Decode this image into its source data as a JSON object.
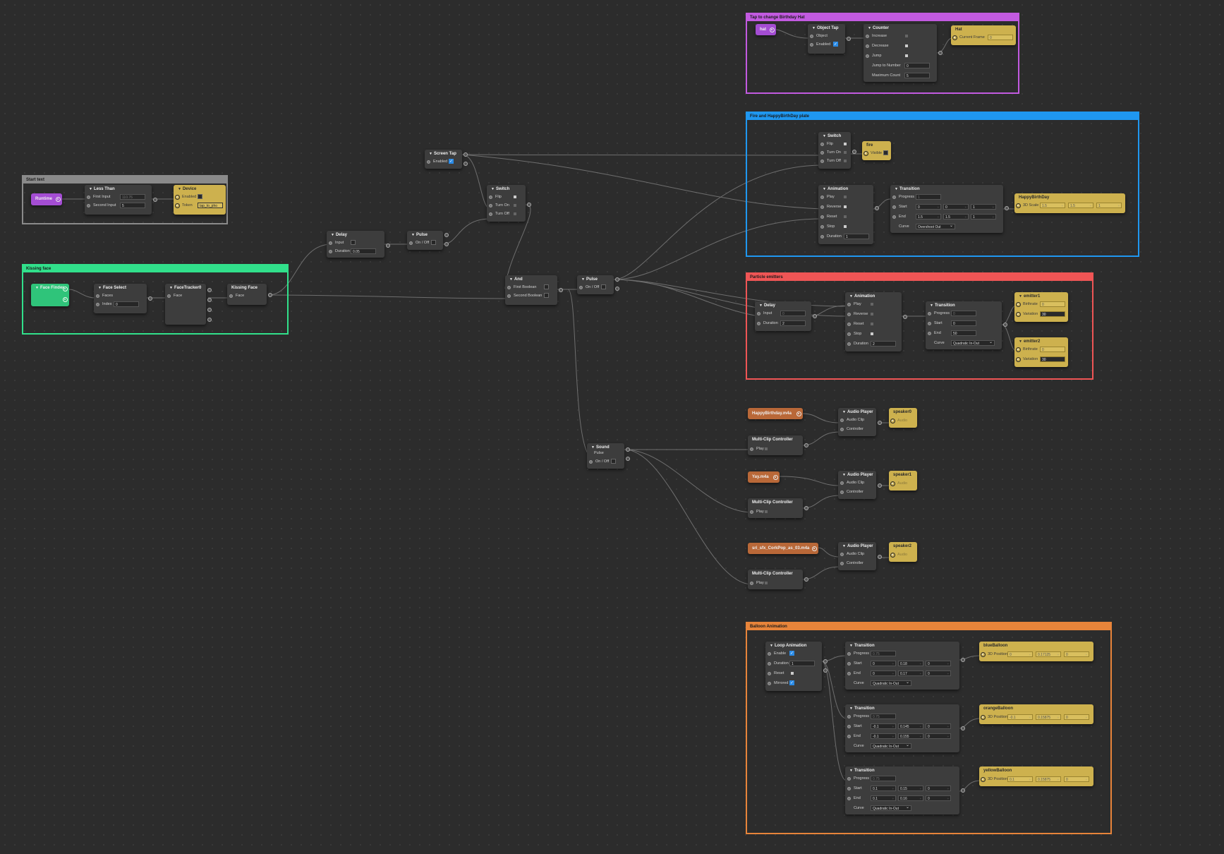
{
  "colors": {
    "background": "#2c2c2c",
    "node": "#3d3d3d",
    "patch_yellow": "#cdb14e",
    "purple": "#a44dd3",
    "green": "#2fc47a",
    "orange_asset": "#b96838",
    "checkbox_blue": "#2b8be6"
  },
  "groups": {
    "start_text": {
      "title": "Start text",
      "color": "#8a8a8a"
    },
    "kissing_face": {
      "title": "Kissing face",
      "color": "#31e08b"
    },
    "birthday_hat": {
      "title": "Tap to change Birthday Hat",
      "color": "#c25ae0"
    },
    "fire_plate": {
      "title": "Fire and HappyBirthDay plate",
      "color": "#1f97f0"
    },
    "particle": {
      "title": "Particle emitters",
      "color": "#ef5555"
    },
    "balloon": {
      "title": "Balloon Animation",
      "color": "#e7843a"
    }
  },
  "nodes": {
    "runtime": {
      "title": "Runtime"
    },
    "less_than": {
      "title": "Less Than",
      "first": "First Input",
      "first_val": "110.76",
      "second": "Second Input",
      "second_val": "5"
    },
    "device": {
      "title": "Device",
      "enabled": "Enabled",
      "token": "Token",
      "token_val": "tap_to_pho"
    },
    "face_finder": {
      "title": "Face Finder"
    },
    "face_select": {
      "title": "Face Select",
      "faces": "Faces",
      "index": "Index",
      "index_val": "0"
    },
    "face_tracker": {
      "title": "FaceTracker0",
      "face": "Face"
    },
    "kissing_face": {
      "title": "Kissing Face",
      "face": "Face"
    },
    "delay1": {
      "title": "Delay",
      "input": "Input",
      "duration": "Duration",
      "duration_val": "0.05"
    },
    "pulse1": {
      "title": "Pulse",
      "onoff": "On / Off"
    },
    "screen_tap": {
      "title": "Screen Tap",
      "enabled": "Enabled"
    },
    "switch1": {
      "title": "Switch",
      "flip": "Flip",
      "turn_on": "Turn On",
      "turn_off": "Turn Off"
    },
    "and": {
      "title": "And",
      "first": "First Boolean",
      "second": "Second Boolean"
    },
    "pulse2": {
      "title": "Pulse",
      "onoff": "On / Off"
    },
    "sound_pulse": {
      "title": "Sound",
      "title2": "Pulse",
      "onoff": "On / Off"
    },
    "hat": {
      "title": "hat"
    },
    "object_tap": {
      "title": "Object Tap",
      "object": "Object",
      "enabled": "Enabled"
    },
    "counter": {
      "title": "Counter",
      "increase": "Increase",
      "decrease": "Decrease",
      "jump": "Jump",
      "jump_to": "Jump to Number",
      "jump_to_val": "0",
      "max": "Maximum Count",
      "max_val": "5"
    },
    "hat_patch": {
      "title": "Hat",
      "current_frame": "Current Frame",
      "current_frame_val": "0"
    },
    "switch2": {
      "title": "Switch",
      "flip": "Flip",
      "turn_on": "Turn On",
      "turn_off": "Turn Off"
    },
    "fire": {
      "title": "fire",
      "visible": "Visible"
    },
    "animation1": {
      "title": "Animation",
      "play": "Play",
      "reverse": "Reverse",
      "reset": "Reset",
      "stop": "Stop",
      "duration": "Duration",
      "duration_val": "1"
    },
    "transition1": {
      "title": "Transition",
      "progress": "Progress",
      "progress_val": "1",
      "start": "Start",
      "start_vals": [
        "0",
        "0",
        "1"
      ],
      "end": "End",
      "end_vals": [
        "1.5",
        "1.5",
        "1"
      ],
      "curve": "Curve",
      "curve_val": "Overshoot Out"
    },
    "happybirthday": {
      "title": "HappyBirthDay",
      "scale": "3D Scale",
      "vals": [
        "1.5",
        "1.5",
        "1"
      ]
    },
    "delay2": {
      "title": "Delay",
      "input": "Input",
      "input_val": "0",
      "duration": "Duration",
      "duration_val": "2"
    },
    "animation2": {
      "title": "Animation",
      "play": "Play",
      "reverse": "Reverse",
      "reset": "Reset",
      "stop": "Stop",
      "duration": "Duration",
      "duration_val": "2"
    },
    "transition2": {
      "title": "Transition",
      "progress": "Progress",
      "progress_val": "0",
      "start": "Start",
      "start_val": "0",
      "end": "End",
      "end_val": "50",
      "curve": "Curve",
      "curve_val": "Quadratic In-Out"
    },
    "emitter1": {
      "title": "emitter1",
      "birthrate": "Birthrate",
      "birthrate_val": "0",
      "variation": "Variation",
      "variation_val": "30"
    },
    "emitter2": {
      "title": "emitter2",
      "birthrate": "Birthrate",
      "birthrate_val": "0",
      "variation": "Variation",
      "variation_val": "30"
    },
    "asset1": {
      "title": "HappyBirthday.m4a"
    },
    "asset2": {
      "title": "Yay.m4a"
    },
    "asset3": {
      "title": "sri_sfx_CorkPop_as_03.m4a"
    },
    "mcc1": {
      "title": "Multi-Clip Controller",
      "play": "Play"
    },
    "mcc2": {
      "title": "Multi-Clip Controller",
      "play": "Play"
    },
    "mcc3": {
      "title": "Multi-Clip Controller",
      "play": "Play"
    },
    "ap1": {
      "title": "Audio Player",
      "clip": "Audio Clip",
      "controller": "Controller"
    },
    "ap2": {
      "title": "Audio Player",
      "clip": "Audio Clip",
      "controller": "Controller"
    },
    "ap3": {
      "title": "Audio Player",
      "clip": "Audio Clip",
      "controller": "Controller"
    },
    "speaker0": {
      "title": "speaker0",
      "audio": "Audio"
    },
    "speaker1": {
      "title": "speaker1",
      "audio": "Audio"
    },
    "speaker2": {
      "title": "speaker2",
      "audio": "Audio"
    },
    "loop": {
      "title": "Loop Animation",
      "enable": "Enable",
      "duration": "Duration",
      "duration_val": "1",
      "reset": "Reset",
      "mirrored": "Mirrored"
    },
    "bt1": {
      "title": "Transition",
      "progress": "Progress",
      "progress_val": "0.75",
      "start": "Start",
      "start_vals": [
        "0",
        "0.18",
        "0"
      ],
      "end": "End",
      "end_vals": [
        "0",
        "0.17",
        "0"
      ],
      "curve": "Curve",
      "curve_val": "Quadratic In-Out"
    },
    "bt2": {
      "title": "Transition",
      "progress": "Progress",
      "progress_val": "0.75",
      "start": "Start",
      "start_vals": [
        "-0.1",
        "0.145",
        "0"
      ],
      "end": "End",
      "end_vals": [
        "-0.1",
        "0.155",
        "0"
      ],
      "curve": "Curve",
      "curve_val": "Quadratic In-Out"
    },
    "bt3": {
      "title": "Transition",
      "progress": "Progress",
      "progress_val": "0.75",
      "start": "Start",
      "start_vals": [
        "0.1",
        "0.15",
        "0"
      ],
      "end": "End",
      "end_vals": [
        "0.1",
        "0.16",
        "0"
      ],
      "curve": "Curve",
      "curve_val": "Quadratic In-Out"
    },
    "blue": {
      "title": "blueBalloon",
      "pos": "3D Position",
      "vals": [
        "0",
        "0.17125",
        "0"
      ]
    },
    "orange": {
      "title": "orangeBalloon",
      "pos": "3D Position",
      "vals": [
        "-0.1",
        "0.15875",
        "0"
      ]
    },
    "yellow": {
      "title": "yellowBalloon",
      "pos": "3D Position",
      "vals": [
        "0.1",
        "0.15875",
        "0"
      ]
    }
  }
}
